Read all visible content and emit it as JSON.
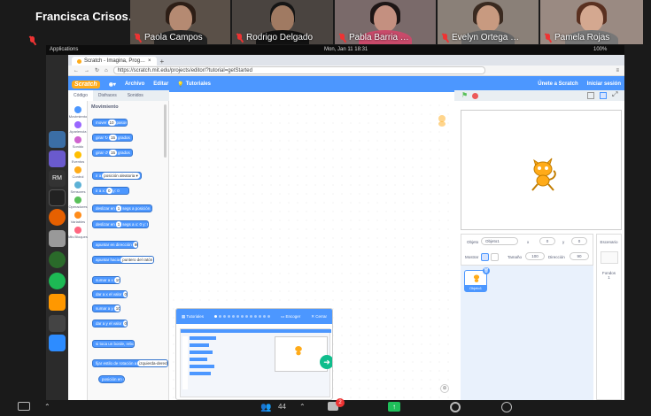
{
  "zoom": {
    "self_name": "Francisca  Crisos…",
    "participants": [
      {
        "name": "Paola Campos"
      },
      {
        "name": "Rodrigo Delgado"
      },
      {
        "name": "Pabla Barria …"
      },
      {
        "name": "Evelyn Ortega …"
      },
      {
        "name": "Pamela Rojas"
      }
    ],
    "participants_count": "44",
    "chat_badge": "2"
  },
  "os": {
    "applications": "Applications",
    "clock": "Mon, Jan 11  18:31",
    "battery": "100%"
  },
  "browser": {
    "tab_title": "Scratch - Imagina, Prog…",
    "new_tab": "+",
    "url": "https://scratch.mit.edu/projects/editor/?tutorial=getStarted"
  },
  "scratch": {
    "logo": "Scratch",
    "menu": [
      "Archivo",
      "Editar"
    ],
    "tutorials": "Tutoriales",
    "join": "Únete a Scratch",
    "signin": "Iniciar sesión",
    "tabs": [
      "Código",
      "Disfraces",
      "Sonidos"
    ],
    "categories": [
      "Movimiento",
      "Apariencia",
      "Sonido",
      "Eventos",
      "Control",
      "Sensores",
      "Operadores",
      "Variables",
      "Mis Bloques"
    ],
    "category_colors": [
      "#4c97ff",
      "#9966ff",
      "#cf63cf",
      "#ffbf00",
      "#ffab19",
      "#5cb1d6",
      "#59c059",
      "#ff8c1a",
      "#ff6680"
    ],
    "palette_title": "Movimiento",
    "blocks": [
      {
        "text": "mover",
        "v": "10",
        "t2": "pasos"
      },
      {
        "text": "girar ↻",
        "v": "15",
        "t2": "grados"
      },
      {
        "text": "girar ↺",
        "v": "15",
        "t2": "grados"
      },
      {
        "text": "ir a",
        "v": "posición aleatoria ▾",
        "t2": ""
      },
      {
        "text": "ir a x:",
        "v": "0",
        "t2": "y: 0"
      },
      {
        "text": "deslizar en",
        "v": "1",
        "t2": "segs a posición aleatoria ▾"
      },
      {
        "text": "deslizar en",
        "v": "1",
        "t2": "segs a x: 0 y: 0"
      },
      {
        "text": "apuntar en dirección",
        "v": "90",
        "t2": ""
      },
      {
        "text": "apuntar hacia",
        "v": "puntero del ratón ▾",
        "t2": ""
      },
      {
        "text": "sumar a x",
        "v": "10",
        "t2": ""
      },
      {
        "text": "dar a x el valor",
        "v": "0",
        "t2": ""
      },
      {
        "text": "sumar a y",
        "v": "10",
        "t2": ""
      },
      {
        "text": "dar a y el valor",
        "v": "0",
        "t2": ""
      },
      {
        "text": "si toca un borde, rebotar",
        "v": "",
        "t2": ""
      },
      {
        "text": "fijar estilo de rotación a",
        "v": "izquierda-derecha ▾",
        "t2": ""
      },
      {
        "text": "posición en x",
        "v": "",
        "t2": ""
      }
    ],
    "sprite": {
      "label": "Objeto",
      "name": "Objeto1",
      "x_label": "x",
      "x": "0",
      "y_label": "y",
      "y": "0",
      "show_label": "Mostrar",
      "size_label": "Tamaño",
      "size": "100",
      "dir_label": "Dirección",
      "dir": "90"
    },
    "stage_panel": {
      "title": "Escenario",
      "backdrops_label": "Fondos",
      "backdrops": "1"
    },
    "tutorial": {
      "tutorials_label": "Tutoriales",
      "shrink": "Encoger",
      "close": "Cerrar"
    }
  }
}
